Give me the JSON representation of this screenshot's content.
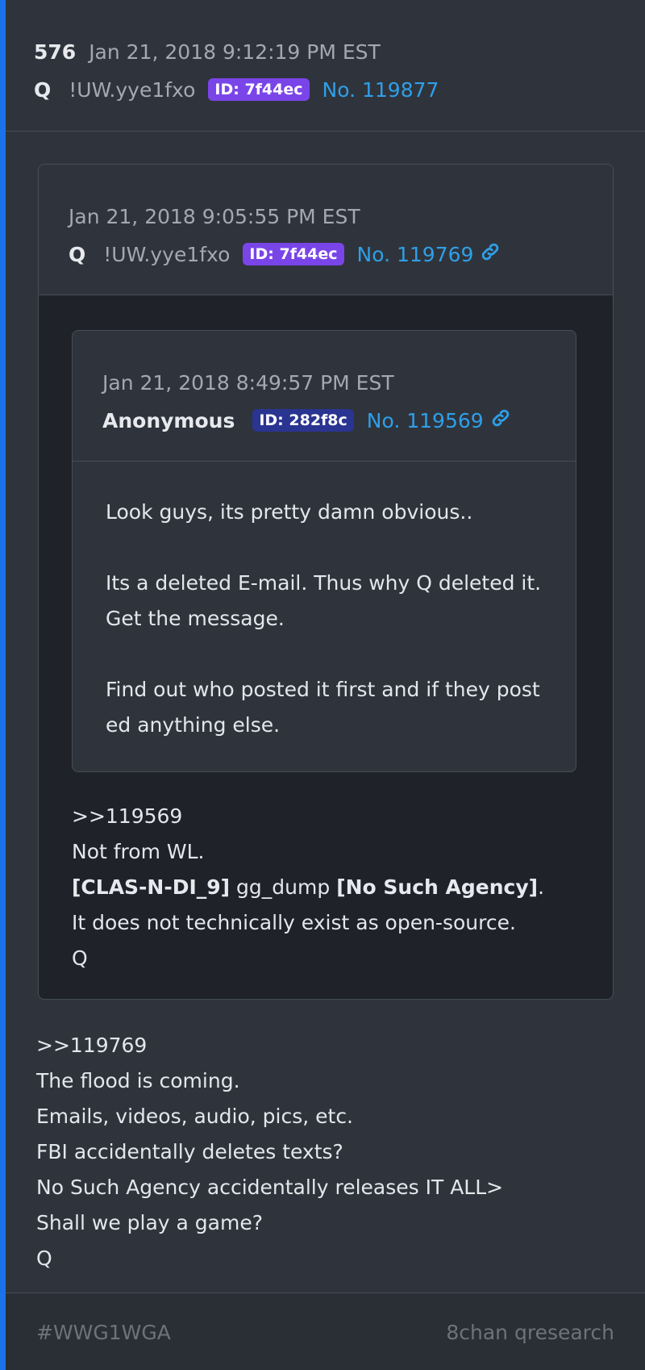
{
  "post": {
    "number": "576",
    "date": "Jan 21, 2018 9:12:19 PM EST",
    "author": "Q",
    "tripcode": "!UW.yye1fxo",
    "id_badge": "ID: 7f44ec",
    "post_no": "No. 119877",
    "body": [
      ">>119769",
      "The flood is coming.",
      "Emails, videos, audio, pics, etc.",
      "FBI accidentally deletes texts?",
      "No Such Agency accidentally releases IT ALL>",
      "Shall we play a game?",
      "Q"
    ]
  },
  "quoted": {
    "date": "Jan 21, 2018 9:05:55 PM EST",
    "author": "Q",
    "tripcode": "!UW.yye1fxo",
    "id_badge": "ID: 7f44ec",
    "post_no": "No. 119769",
    "body": {
      "line1": ">>119569",
      "line2": "Not from WL.",
      "line3_bold1": "[CLAS-N-DI_9]",
      "line3_mid": " gg_dump ",
      "line3_bold2": "[No Such Agency]",
      "line3_end": ".",
      "line4": "It does not technically exist as open-source.",
      "line5": "Q"
    }
  },
  "nested": {
    "date": "Jan 21, 2018 8:49:57 PM EST",
    "author": "Anonymous",
    "id_badge": "ID: 282f8c",
    "post_no": "No. 119569",
    "body": {
      "p1": "Look guys, its pretty damn obvious..",
      "p2a": "Its a deleted E-mail. Thus why Q deleted it.",
      "p2b": "Get the message.",
      "p3a": "Find out who posted it first and if they post",
      "p3b": "ed anything else."
    }
  },
  "footer": {
    "tag": "#WWG1WGA",
    "source": "8chan qresearch"
  },
  "colors": {
    "accent": "#1a73e8",
    "link": "#2f9fe8",
    "badge_q": "#7a45e8",
    "badge_anon": "#2a3491"
  }
}
